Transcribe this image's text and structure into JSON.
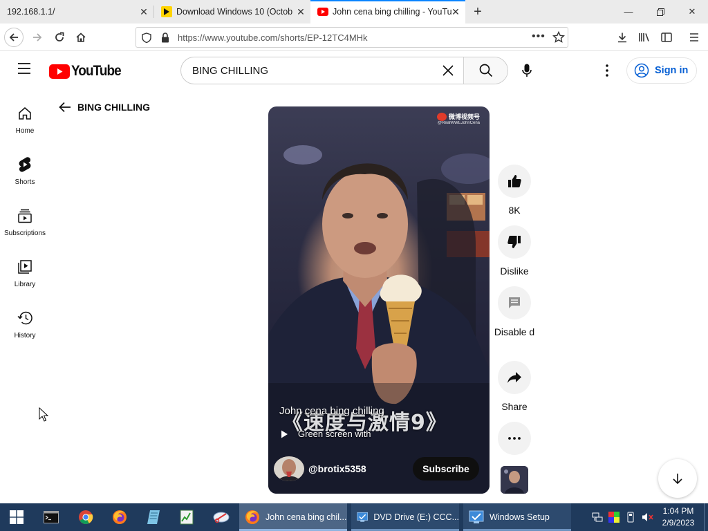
{
  "browser": {
    "tabs": [
      {
        "title": "192.168.1.1/",
        "active": false
      },
      {
        "title": "Download Windows 10 (Octob",
        "active": false
      },
      {
        "title": "John cena bing chilling - YouTu",
        "active": true
      }
    ],
    "url": "https://www.youtube.com/shorts/EP-12TC4MHk"
  },
  "youtube": {
    "logo_text": "YouTube",
    "search_value": "BING CHILLING",
    "signin_label": "Sign in",
    "page_heading": "BING CHILLING",
    "sidebar": [
      {
        "label": "Home",
        "icon": "home-icon"
      },
      {
        "label": "Shorts",
        "icon": "shorts-icon"
      },
      {
        "label": "Subscriptions",
        "icon": "subscriptions-icon"
      },
      {
        "label": "Library",
        "icon": "library-icon"
      },
      {
        "label": "History",
        "icon": "history-icon"
      }
    ],
    "short": {
      "title": "John cena bing chilling",
      "overlay_text": "《速度与激情9》",
      "watermark": "微博视频号",
      "watermark_handle": "@RealWWEJohnCena",
      "audio": "Green screen with",
      "channel": "@brotix5358",
      "subscribe_label": "Subscribe"
    },
    "actions": {
      "like": "8K",
      "dislike": "Dislike",
      "comments": "Disable d",
      "share": "Share"
    }
  },
  "taskbar": {
    "windows": [
      {
        "title": "John cena bing chil...",
        "active": true
      },
      {
        "title": "DVD Drive (E:) CCC...",
        "active": false
      },
      {
        "title": "Windows Setup",
        "active": false
      }
    ],
    "time": "1:04 PM",
    "date": "2/9/2023"
  },
  "colors": {
    "youtube_red": "#ff0000",
    "link_blue": "#065fd4",
    "taskbar": "#1f3a5c",
    "tab_accent": "#0a84ff"
  }
}
